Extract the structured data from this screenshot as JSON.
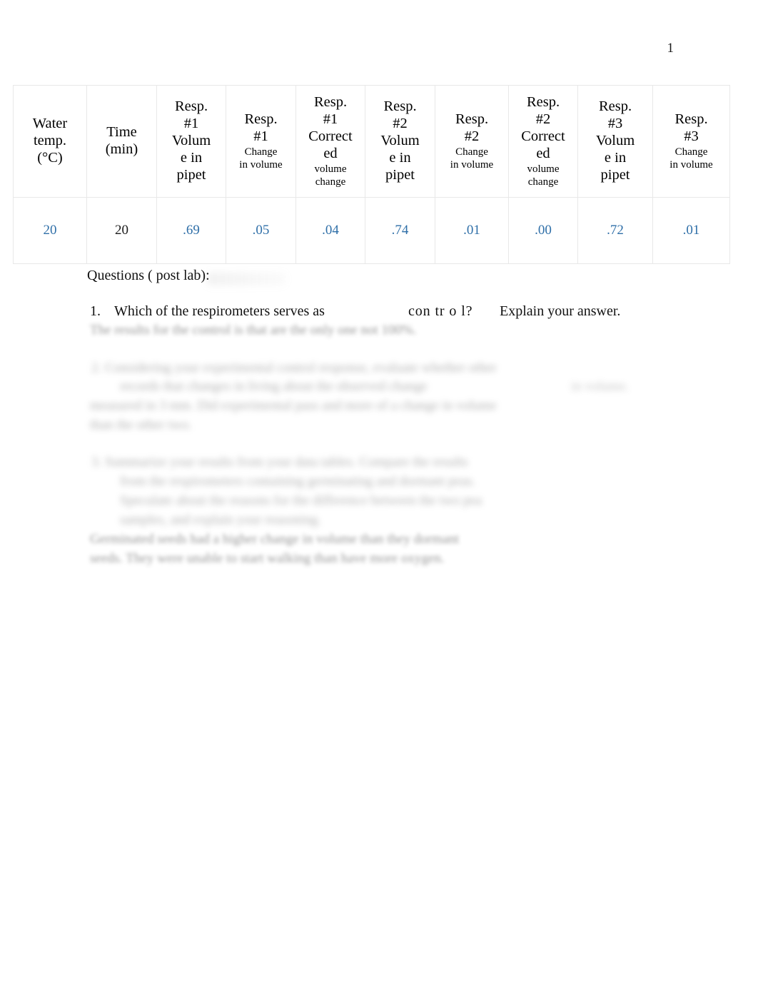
{
  "document": {
    "page_number": "1",
    "colors": {
      "entered_value_blue": "#2f6fa8",
      "body_text": "#111111",
      "table_border": "#e8e8e8",
      "page_background": "#ffffff"
    }
  },
  "table": {
    "columns": [
      {
        "id": "water-temp",
        "main_lines": [
          "Water",
          "temp.",
          "(°C)"
        ],
        "sub_lines": []
      },
      {
        "id": "time-min",
        "main_lines": [
          "Time",
          "(min)"
        ],
        "sub_lines": []
      },
      {
        "id": "resp1-volume-in-pipet",
        "main_lines": [
          "Resp.",
          "#1",
          "Volum",
          "e in",
          "pipet"
        ],
        "sub_lines": []
      },
      {
        "id": "resp1-change-in-volume",
        "main_lines": [
          "Resp.",
          "#1"
        ],
        "sub_lines": [
          "Change",
          "in volume"
        ]
      },
      {
        "id": "resp1-corrected-volume-change",
        "main_lines": [
          "Resp.",
          "#1",
          "Correct",
          "ed"
        ],
        "sub_lines": [
          "volume",
          "change"
        ]
      },
      {
        "id": "resp2-volume-in-pipet",
        "main_lines": [
          "Resp.",
          "#2",
          "Volum",
          "e in",
          "pipet"
        ],
        "sub_lines": []
      },
      {
        "id": "resp2-change-in-volume",
        "main_lines": [
          "Resp.",
          "#2"
        ],
        "sub_lines": [
          "Change",
          "in volume"
        ]
      },
      {
        "id": "resp2-corrected-volume-change",
        "main_lines": [
          "Resp.",
          "#2",
          "Correct",
          "ed"
        ],
        "sub_lines": [
          "volume",
          "change"
        ]
      },
      {
        "id": "resp3-volume-in-pipet",
        "main_lines": [
          "Resp.",
          "#3",
          "Volum",
          "e  in",
          "pipet"
        ],
        "sub_lines": []
      },
      {
        "id": "resp3-change-in-volume",
        "main_lines": [
          "Resp.",
          "#3"
        ],
        "sub_lines": [
          "Change",
          "in volume"
        ]
      }
    ],
    "rows": [
      {
        "cells": [
          {
            "value": "20",
            "style": "blue"
          },
          {
            "value": "20",
            "style": "black"
          },
          {
            "value": ".69",
            "style": "blue"
          },
          {
            "value": ".05",
            "style": "blue"
          },
          {
            "value": ".04",
            "style": "blue"
          },
          {
            "value": ".74",
            "style": "blue"
          },
          {
            "value": ".01",
            "style": "blue"
          },
          {
            "value": ".00",
            "style": "blue"
          },
          {
            "value": ".72",
            "style": "blue"
          },
          {
            "value": ".01",
            "style": "blue"
          }
        ]
      }
    ]
  },
  "questions_section": {
    "heading": "Questions ( post lab):",
    "q1": {
      "number": "1.",
      "text_before_blank": "Which of the respirometers serves as",
      "text_blank_word": "con  tr  o l?",
      "text_after_blank": "Explain your answer."
    },
    "blurred_answers": [
      {
        "id": "q1-answer-line-1",
        "text": "The results for the control is that are the only one not 100%."
      },
      {
        "id": "q2-line-1",
        "text": "2.  Considering your experimental control response, evaluate whether other"
      },
      {
        "id": "q2-line-2",
        "text": "records that    changes in living about the observed change"
      },
      {
        "id": "q2-line-2b",
        "text": "in volume."
      },
      {
        "id": "q2-line-3",
        "text": "measured in 3 mm. Did experimental pass and more of a change in volume"
      },
      {
        "id": "q2-line-4",
        "text": "than the other two."
      },
      {
        "id": "q3-line-1",
        "text": "3.  Summarize your results from your data tables.  Compare the results"
      },
      {
        "id": "q3-line-2",
        "text": "from the respirometers containing germinating and dormant peas."
      },
      {
        "id": "q3-line-3",
        "text": "Speculate about the reasons for the difference between the two pea"
      },
      {
        "id": "q3-line-4",
        "text": "samples, and explain your reasoning."
      },
      {
        "id": "q3-answer-line-1",
        "text": "Germinated seeds had a higher change in volume than they dormant"
      },
      {
        "id": "q3-answer-line-2",
        "text": "seeds. They were unable to start walking than have more oxygen."
      }
    ]
  }
}
